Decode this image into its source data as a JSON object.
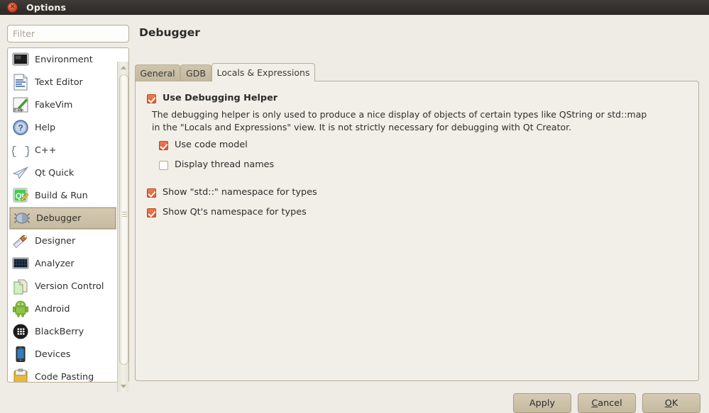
{
  "window": {
    "title": "Options",
    "close_icon": "close-icon",
    "close_glyph": "✕"
  },
  "sidebar": {
    "filter": {
      "value": "",
      "placeholder": "Filter"
    },
    "items": [
      {
        "label": "Environment",
        "icon": "monitor-icon",
        "selected": false
      },
      {
        "label": "Text Editor",
        "icon": "text-document-icon",
        "selected": false
      },
      {
        "label": "FakeVim",
        "icon": "fakevim-icon",
        "selected": false
      },
      {
        "label": "Help",
        "icon": "help-question-icon",
        "selected": false
      },
      {
        "label": "C++",
        "icon": "braces-icon",
        "selected": false
      },
      {
        "label": "Qt Quick",
        "icon": "paper-plane-icon",
        "selected": false
      },
      {
        "label": "Build & Run",
        "icon": "qt-build-icon",
        "selected": false
      },
      {
        "label": "Debugger",
        "icon": "bug-icon",
        "selected": true
      },
      {
        "label": "Designer",
        "icon": "ruler-pen-icon",
        "selected": false
      },
      {
        "label": "Analyzer",
        "icon": "analyzer-grid-icon",
        "selected": false
      },
      {
        "label": "Version Control",
        "icon": "copy-pages-icon",
        "selected": false
      },
      {
        "label": "Android",
        "icon": "android-robot-icon",
        "selected": false
      },
      {
        "label": "BlackBerry",
        "icon": "blackberry-icon",
        "selected": false
      },
      {
        "label": "Devices",
        "icon": "phone-device-icon",
        "selected": false
      },
      {
        "label": "Code Pasting",
        "icon": "clipboard-icon",
        "selected": false
      }
    ],
    "scrollbar": {
      "up_arrow": "scroll-up-arrow",
      "down_arrow": "scroll-down-arrow"
    }
  },
  "main": {
    "title": "Debugger",
    "tabs": [
      {
        "label": "General",
        "active": false
      },
      {
        "label": "GDB",
        "active": false
      },
      {
        "label": "Locals & Expressions",
        "active": true
      }
    ],
    "use_debugging_helper": {
      "label": "Use Debugging Helper",
      "checked": true
    },
    "description_line1": "The debugging helper is only used to produce a nice display of objects of certain types like QString or std::map",
    "description_line2": "in the \"Locals and Expressions\" view. It is not strictly necessary for debugging with Qt Creator.",
    "sub_options": [
      {
        "label": "Use code model",
        "checked": true
      },
      {
        "label": "Display thread names",
        "checked": false
      }
    ],
    "namespace_options": [
      {
        "label": "Show \"std::\" namespace for types",
        "checked": true
      },
      {
        "label": "Show Qt's namespace for types",
        "checked": true
      }
    ]
  },
  "footer": {
    "apply": {
      "label": "Apply",
      "mnemonic": ""
    },
    "cancel": {
      "label": "Cancel",
      "mnemonic": "C"
    },
    "ok": {
      "label": "OK",
      "mnemonic": "O"
    }
  },
  "colors": {
    "accent_check": "#e25c32",
    "dialog_bg": "#efece5",
    "panel_bg": "#f2efe8",
    "tab_inactive": "#c3b89e",
    "titlebar": "#332f2c",
    "selection": "#cbc0a6"
  }
}
